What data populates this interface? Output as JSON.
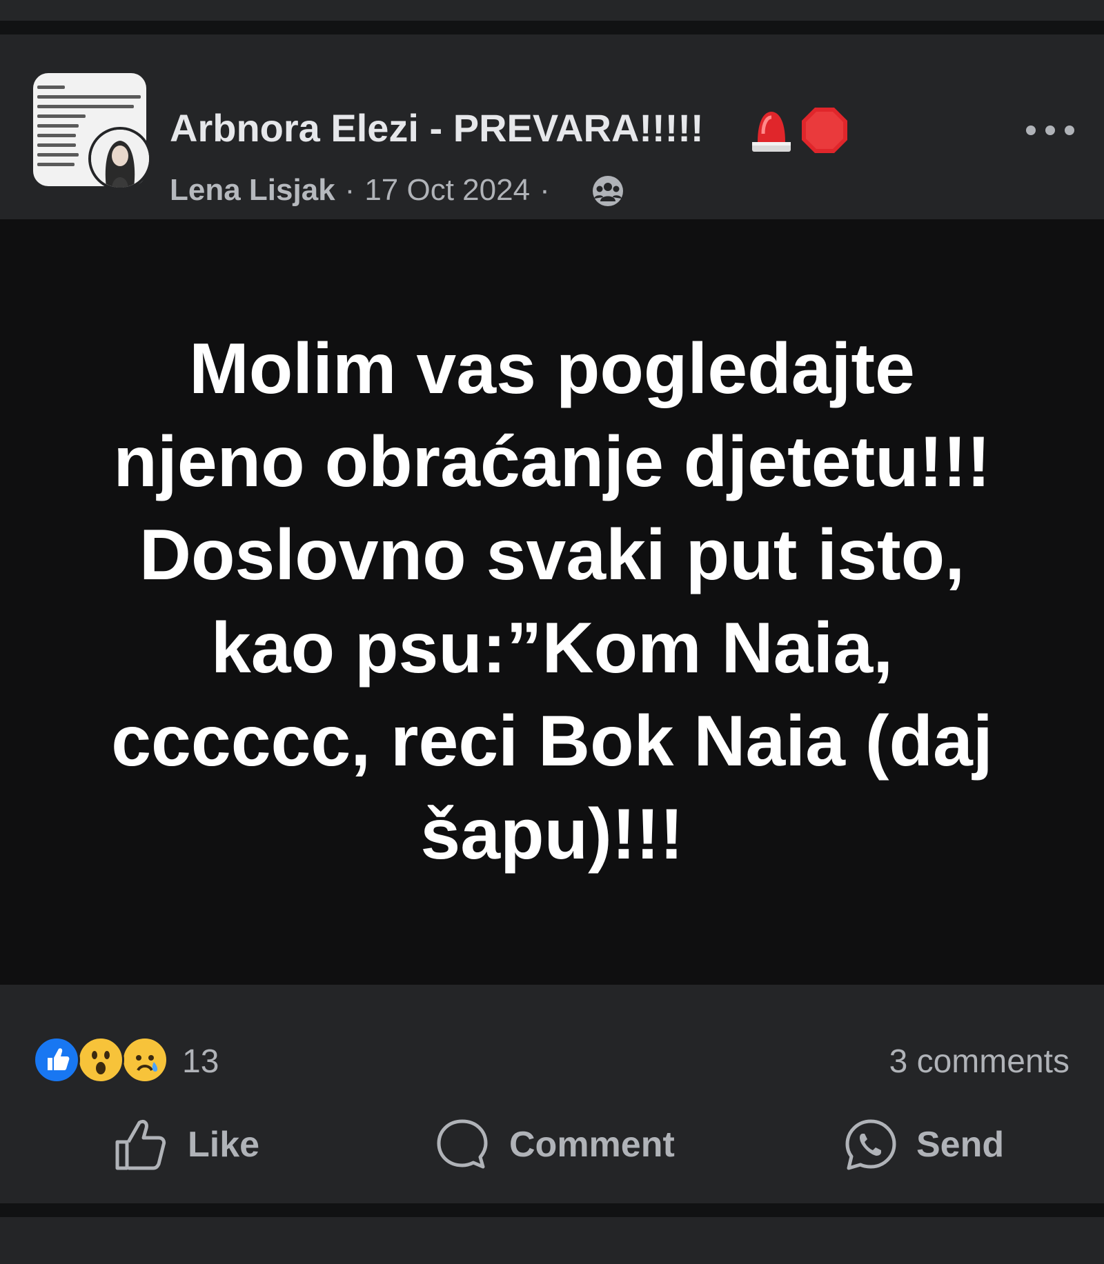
{
  "post": {
    "title": "Arbnora Elezi - PREVARA!!!!!",
    "author": "Lena Lisjak",
    "date": "17 Oct 2024",
    "separator": "·",
    "privacy_icon": "group-icon",
    "title_emojis": [
      "police-light-emoji",
      "stop-sign-emoji"
    ],
    "content_text": "Molim vas pogledajte\nnjeno obraćanje djetetu!!!\nDoslovno svaki put isto,\nkao psu:”Kom Naia,\ncccccc, reci Bok Naia (daj\nšapu)!!!",
    "content_background": "#0f0f10",
    "reactions": {
      "icons": [
        "like-reaction-icon",
        "wow-reaction-icon",
        "sad-reaction-icon"
      ],
      "count": "13",
      "comments": "3 comments"
    },
    "actions": {
      "like": "Like",
      "comment": "Comment",
      "send": "Send"
    }
  },
  "colors": {
    "like_blue": "#1877f2",
    "emoji_yellow": "#f7c33a",
    "alert_red": "#e0262b",
    "text_secondary": "#b0b3b8"
  }
}
